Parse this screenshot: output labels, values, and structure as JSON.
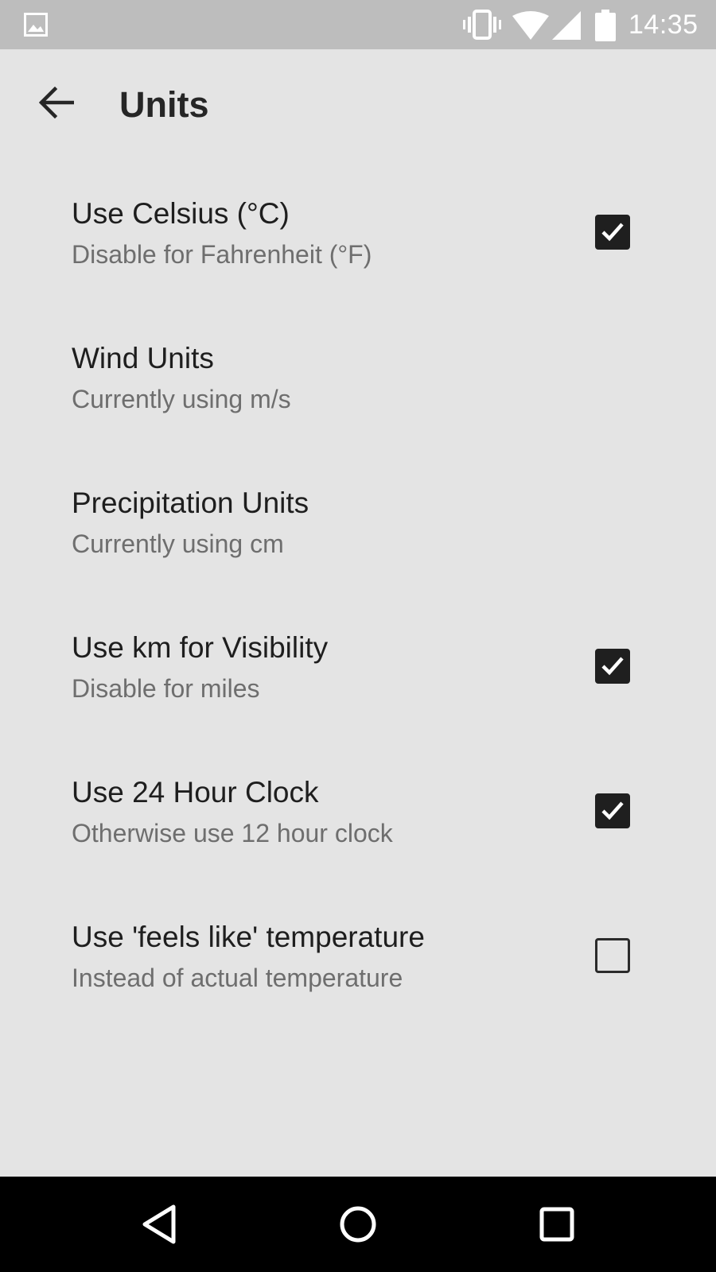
{
  "status_bar": {
    "time": "14:35",
    "icons": [
      "gallery-icon",
      "vibrate-icon",
      "wifi-icon",
      "signal-icon",
      "battery-icon"
    ]
  },
  "app_bar": {
    "title": "Units",
    "back_icon": "arrow-back-icon"
  },
  "settings": [
    {
      "title": "Use Celsius (°C)",
      "summary": "Disable for Fahrenheit (°F)",
      "has_checkbox": true,
      "checked": true
    },
    {
      "title": "Wind Units",
      "summary": "Currently using m/s",
      "has_checkbox": false
    },
    {
      "title": "Precipitation Units",
      "summary": "Currently using cm",
      "has_checkbox": false
    },
    {
      "title": "Use km for Visibility",
      "summary": "Disable for miles",
      "has_checkbox": true,
      "checked": true
    },
    {
      "title": "Use 24 Hour Clock",
      "summary": "Otherwise use 12 hour clock",
      "has_checkbox": true,
      "checked": true
    },
    {
      "title": "Use 'feels like' temperature",
      "summary": "Instead of actual temperature",
      "has_checkbox": true,
      "checked": false
    }
  ],
  "nav_bar": {
    "icons": [
      "nav-back-icon",
      "nav-home-icon",
      "nav-recents-icon"
    ]
  },
  "colors": {
    "background": "#e4e4e4",
    "status_bar": "#bdbdbd",
    "nav_bar": "#000000",
    "title_text": "#1e1e1e",
    "summary_text": "#6e6e6e"
  }
}
